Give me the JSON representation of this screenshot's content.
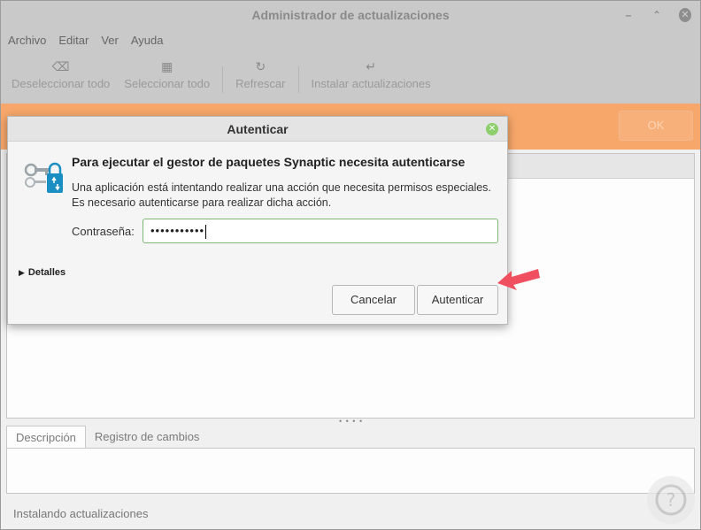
{
  "window": {
    "title": "Administrador de actualizaciones",
    "controls": [
      "minimize",
      "restore",
      "close"
    ]
  },
  "menubar": [
    "Archivo",
    "Editar",
    "Ver",
    "Ayuda"
  ],
  "toolbar": {
    "deselect": {
      "label": "Deseleccionar todo",
      "icon": "backspace-icon"
    },
    "select": {
      "label": "Seleccionar todo",
      "icon": "grid-icon"
    },
    "refresh": {
      "label": "Refrescar",
      "icon": "refresh-icon"
    },
    "install": {
      "label": "Instalar actualizaciones",
      "icon": "return-icon"
    }
  },
  "banner": {
    "ok_label": "OK"
  },
  "tabs": {
    "description": "Descripción",
    "changelog": "Registro de cambios"
  },
  "status": "Instalando actualizaciones",
  "dialog": {
    "title": "Autenticar",
    "heading": "Para ejecutar el gestor de paquetes Synaptic necesita autenticarse",
    "message_line1": "Una aplicación está intentando realizar una acción que necesita permisos especiales.",
    "message_line2": "Es necesario autenticarse para realizar dicha acción.",
    "password_label": "Contraseña:",
    "password_value": "•••••••••••",
    "details_label": "Detalles",
    "cancel_label": "Cancelar",
    "auth_label": "Autenticar"
  },
  "colors": {
    "accent_orange": "#f7a76a",
    "focus_green": "#7fb673",
    "arrow_red": "#ef4f5f"
  }
}
